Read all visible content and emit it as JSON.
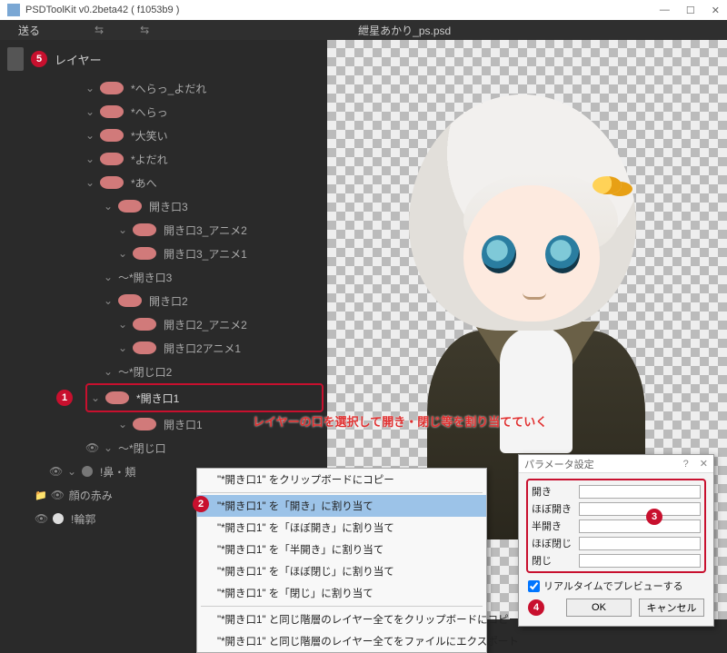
{
  "window": {
    "title": "PSDToolKit v0.2beta42 ( f1053b9 )",
    "min": "—",
    "max": "☐",
    "close": "✕"
  },
  "menubar": {
    "send": "送る",
    "arrow1": "⇆",
    "arrow2": "⇆",
    "filename": "紲星あかり_ps.psd"
  },
  "sidebar": {
    "badge5": "5",
    "header": "レイヤー",
    "layers": [
      {
        "name": "*へらっ_よだれ"
      },
      {
        "name": "*へらっ"
      },
      {
        "name": "*大笑い"
      },
      {
        "name": "*よだれ"
      },
      {
        "name": "*あへ"
      },
      {
        "name": "開き口3"
      },
      {
        "name": "開き口3_アニメ2"
      },
      {
        "name": "開き口3_アニメ1"
      },
      {
        "name": "〜*開き口3"
      },
      {
        "name": "開き口2"
      },
      {
        "name": "開き口2_アニメ2"
      },
      {
        "name": "開き口2アニメ1"
      },
      {
        "name": "〜*閉じ口2"
      },
      {
        "name": "*開き口1"
      },
      {
        "name": "開き口1"
      },
      {
        "name": "〜*閉じ口"
      },
      {
        "name": "!鼻・頬"
      },
      {
        "name": "顔の赤み"
      },
      {
        "name": "!輪郭"
      }
    ],
    "badge1": "1"
  },
  "annotation": "レイヤーの口を選択して開き・閉じ等を割り当てていく",
  "ctxmenu": {
    "badge2": "2",
    "items": [
      "\"*開き口1\" をクリップボードにコピー",
      "\"*開き口1\" を「開き」に割り当て",
      "\"*開き口1\" を「ほぼ開き」に割り当て",
      "\"*開き口1\" を「半開き」に割り当て",
      "\"*開き口1\" を「ほぼ閉じ」に割り当て",
      "\"*開き口1\" を「閉じ」に割り当て",
      "\"*開き口1\" と同じ階層のレイヤー全てをクリップボードにコピー",
      "\"*開き口1\" と同じ階層のレイヤー全てをファイルにエクスポート"
    ]
  },
  "dialog": {
    "title": "パラメータ設定",
    "q": "?",
    "x": "✕",
    "params": [
      "開き",
      "ほぼ開き",
      "半開き",
      "ほぼ閉じ",
      "閉じ"
    ],
    "badge3": "3",
    "preview_chk": "リアルタイムでプレビューする",
    "badge4": "4",
    "ok": "OK",
    "cancel": "キャンセル"
  }
}
